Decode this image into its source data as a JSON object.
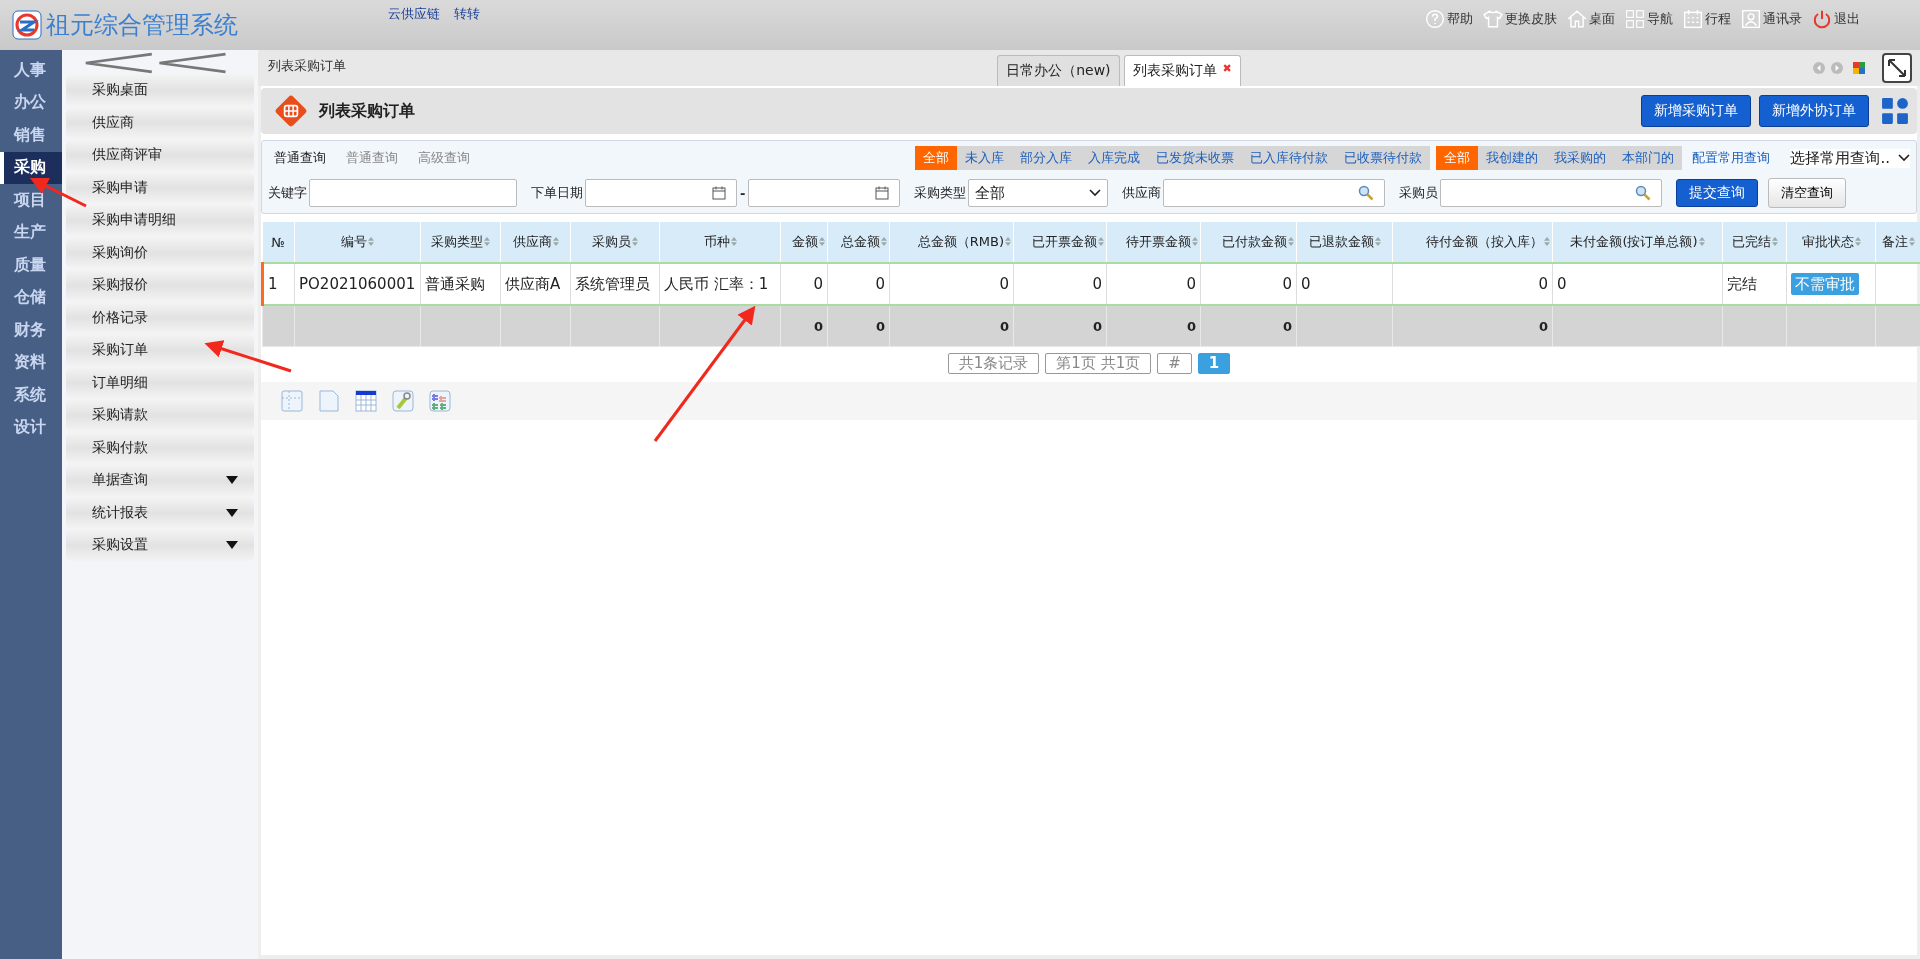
{
  "header": {
    "app_name": "祖元综合管理系统",
    "links": [
      "云供应链",
      "转转"
    ],
    "actions": [
      {
        "kind": "help",
        "label": "帮助"
      },
      {
        "kind": "skin",
        "label": "更换皮肤"
      },
      {
        "kind": "desktop",
        "label": "桌面"
      },
      {
        "kind": "nav",
        "label": "导航"
      },
      {
        "kind": "schedule",
        "label": "行程"
      },
      {
        "kind": "contacts",
        "label": "通讯录"
      },
      {
        "kind": "logout",
        "label": "退出"
      }
    ]
  },
  "nav": {
    "items": [
      {
        "label": "人事",
        "selected": false
      },
      {
        "label": "办公",
        "selected": false
      },
      {
        "label": "销售",
        "selected": false
      },
      {
        "label": "采购",
        "selected": true
      },
      {
        "label": "项目",
        "selected": false
      },
      {
        "label": "生产",
        "selected": false
      },
      {
        "label": "质量",
        "selected": false
      },
      {
        "label": "仓储",
        "selected": false
      },
      {
        "label": "财务",
        "selected": false
      },
      {
        "label": "资料",
        "selected": false
      },
      {
        "label": "系统",
        "selected": false
      },
      {
        "label": "设计",
        "selected": false
      }
    ]
  },
  "submenu": {
    "items": [
      {
        "label": "采购桌面",
        "expandable": false
      },
      {
        "label": "供应商",
        "expandable": false
      },
      {
        "label": "供应商评审",
        "expandable": false
      },
      {
        "label": "采购申请",
        "expandable": false
      },
      {
        "label": "采购申请明细",
        "expandable": false
      },
      {
        "label": "采购询价",
        "expandable": false
      },
      {
        "label": "采购报价",
        "expandable": false
      },
      {
        "label": "价格记录",
        "expandable": false
      },
      {
        "label": "采购订单",
        "expandable": false
      },
      {
        "label": "订单明细",
        "expandable": false
      },
      {
        "label": "采购请款",
        "expandable": false
      },
      {
        "label": "采购付款",
        "expandable": false
      },
      {
        "label": "单据查询",
        "expandable": true
      },
      {
        "label": "统计报表",
        "expandable": true
      },
      {
        "label": "采购设置",
        "expandable": true
      }
    ]
  },
  "breadcrumb": "列表采购订单",
  "tabs": [
    {
      "label": "日常办公（new)",
      "selected": false
    },
    {
      "label": "列表采购订单",
      "selected": true,
      "close": "✖"
    }
  ],
  "page": {
    "title": "列表采购订单",
    "buttons": [
      "新增采购订单",
      "新增外协订单"
    ]
  },
  "query_modes": [
    {
      "label": "普通查询",
      "selected": true
    },
    {
      "label": "普通查询",
      "selected": false
    },
    {
      "label": "高级查询",
      "selected": false
    }
  ],
  "status_filters": [
    {
      "label": "全部",
      "selected": true
    },
    {
      "label": "未入库",
      "selected": false
    },
    {
      "label": "部分入库",
      "selected": false
    },
    {
      "label": "入库完成",
      "selected": false
    },
    {
      "label": "已发货未收票",
      "selected": false
    },
    {
      "label": "已入库待付款",
      "selected": false
    },
    {
      "label": "已收票待付款",
      "selected": false
    }
  ],
  "owner_filters": [
    {
      "label": "全部",
      "selected": true
    },
    {
      "label": "我创建的",
      "selected": false
    },
    {
      "label": "我采购的",
      "selected": false
    },
    {
      "label": "本部门的",
      "selected": false
    }
  ],
  "config_link": "配置常用查询",
  "saved_query": {
    "value": "选择常用查询.."
  },
  "fields": {
    "keyword_label": "关键字",
    "date_label": "下单日期",
    "date_separator": "-",
    "type_label": "采购类型",
    "type_value": "全部",
    "supplier_label": "供应商",
    "buyer_label": "采购员"
  },
  "query_buttons": {
    "submit": "提交查询",
    "clear": "清空查询"
  },
  "table": {
    "columns": [
      {
        "label": "№",
        "kind": "text",
        "sortable": false
      },
      {
        "label": "编号",
        "kind": "text",
        "sortable": true
      },
      {
        "label": "采购类型",
        "kind": "text",
        "sortable": true
      },
      {
        "label": "供应商",
        "kind": "text",
        "sortable": true
      },
      {
        "label": "采购员",
        "kind": "text",
        "sortable": true
      },
      {
        "label": "币种",
        "kind": "text",
        "sortable": true
      },
      {
        "label": "金额",
        "kind": "number",
        "sortable": true,
        "total": "0"
      },
      {
        "label": "总金额",
        "kind": "number",
        "sortable": true,
        "total": "0"
      },
      {
        "label": "总金额（RMB)",
        "kind": "number",
        "sortable": true,
        "total": "0"
      },
      {
        "label": "已开票金额",
        "kind": "number",
        "sortable": true,
        "total": "0"
      },
      {
        "label": "待开票金额",
        "kind": "number",
        "sortable": true,
        "total": "0"
      },
      {
        "label": "已付款金额",
        "kind": "number",
        "sortable": true,
        "total": "0"
      },
      {
        "label": "已退款金额",
        "kind": "text",
        "sortable": true
      },
      {
        "label": "待付金额（按入库）",
        "kind": "number",
        "sortable": true,
        "total": "0"
      },
      {
        "label": "未付金额(按订单总额)",
        "kind": "text",
        "sortable": true
      },
      {
        "label": "已完结",
        "kind": "text",
        "sortable": true
      },
      {
        "label": "审批状态",
        "kind": "badge",
        "sortable": true
      },
      {
        "label": "备注",
        "kind": "text",
        "sortable": true
      }
    ],
    "rows": [
      {
        "selected": true,
        "cells": [
          "1",
          "PO2021060001",
          "普通采购",
          "供应商A",
          "系统管理员",
          "人民币 汇率：1",
          "0",
          "0",
          "0",
          "0",
          "0",
          "0",
          "0",
          "0",
          "0",
          "完结",
          "不需审批"
        ]
      }
    ]
  },
  "pagination": {
    "summary": [
      "共1条记录",
      "第1页 共1页",
      "#"
    ],
    "pages": [
      {
        "label": "1",
        "selected": true
      }
    ]
  }
}
